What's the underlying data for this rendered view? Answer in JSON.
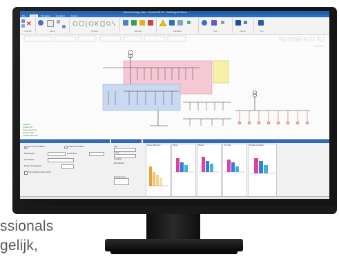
{
  "background": {
    "line1": "ssionals",
    "line2": "gelijk,"
  },
  "window": {
    "title": "Elecdes design suite - Normal-ASI.R2 – Multilingual Ribbon",
    "tabs": [
      "File",
      "Home",
      "Simulation",
      "Quotation",
      "Report"
    ],
    "active_tab": "Home"
  },
  "ribbon": {
    "groups": [
      "Clipboard",
      "Editing",
      "Symbols",
      "Elements",
      "Calculation",
      "Tools",
      "Report",
      "Find"
    ]
  },
  "canvas": {
    "project_title": "Normal-ASI R2",
    "project_subtitle": "LowPlan",
    "legend": [
      "Legend:",
      "Cables OK",
      "Fuse selectivity",
      "Earthing OK",
      "Voltage drop OK"
    ]
  },
  "panel": {
    "left": {
      "options": [
        "Normal simulation",
        "Phase simulation"
      ],
      "fields": [
        "Result type",
        "Load factor",
        "Calculation",
        "Report simultaneity",
        "Symmetrical short-circuit"
      ]
    },
    "middle": {
      "labels": [
        "Tag",
        "Level",
        "Location",
        "Description",
        "Environment"
      ]
    },
    "charts": {
      "titles": [
        "Power difference",
        "Phase",
        "Phase 1",
        "Line Size",
        "Parallel calculation"
      ]
    }
  },
  "colors": {
    "title_bar": "#1f5fb0",
    "ribbon_bg": "#f3f3f3",
    "diagram_pink": "#f6c8d6",
    "diagram_blue": "#c9d9f2",
    "diagram_yellow": "#f7f0a8",
    "bezel": "#161616",
    "background_text": "#555a5f"
  }
}
